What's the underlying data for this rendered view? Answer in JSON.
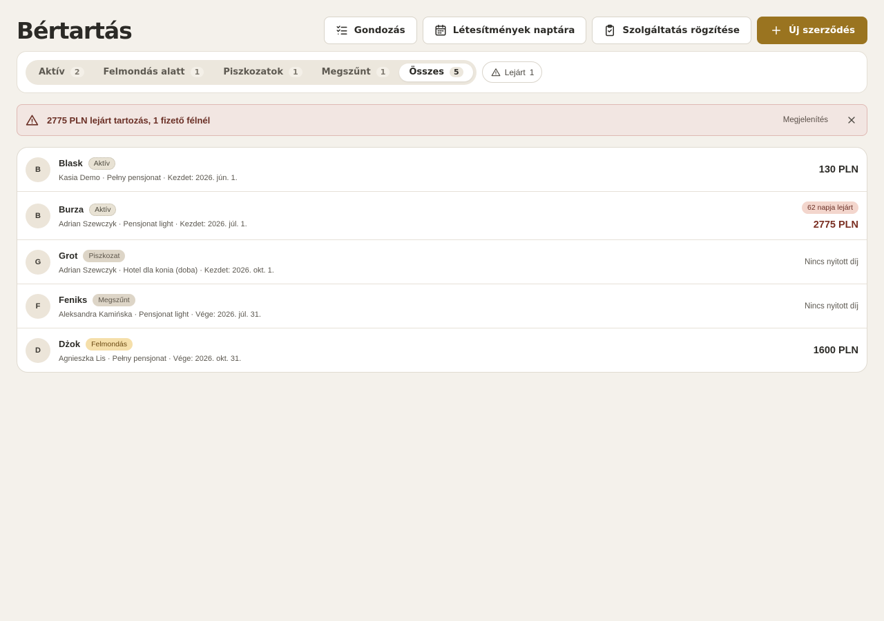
{
  "header": {
    "title": "Bértartás",
    "buttons": {
      "care": "Gondozás",
      "calendar": "Létesítmények naptára",
      "service": "Szolgáltatás rögzítése",
      "new_contract": "Új szerződés"
    }
  },
  "filters": {
    "tabs": [
      {
        "label": "Aktív",
        "count": "2"
      },
      {
        "label": "Felmondás alatt",
        "count": "1"
      },
      {
        "label": "Piszkozatok",
        "count": "1"
      },
      {
        "label": "Megszűnt",
        "count": "1"
      },
      {
        "label": "Összes",
        "count": "5"
      }
    ],
    "overdue": {
      "label": "Lejárt",
      "count": "1"
    }
  },
  "alert": {
    "text": "2775 PLN lejárt tartozás, 1 fizető félnél",
    "action": "Megjelenítés"
  },
  "contracts": [
    {
      "initial": "B",
      "name": "Blask",
      "status": "Aktív",
      "meta": "Kasia Demo · Pełny pensjonat · Kezdet: 2026. jún. 1.",
      "amount": "130 PLN"
    },
    {
      "initial": "B",
      "name": "Burza",
      "status": "Aktív",
      "meta": "Adrian Szewczyk · Pensjonat light · Kezdet: 2026. júl. 1.",
      "due": "62 napja lejárt",
      "amount": "2775 PLN"
    },
    {
      "initial": "G",
      "name": "Grot",
      "status": "Piszkozat",
      "meta": "Adrian Szewczyk · Hotel dla konia (doba) · Kezdet: 2026. okt. 1.",
      "none": "Nincs nyitott díj"
    },
    {
      "initial": "F",
      "name": "Feniks",
      "status": "Megszűnt",
      "meta": "Aleksandra Kamińska · Pensjonat light · Vége: 2026. júl. 31.",
      "none": "Nincs nyitott díj"
    },
    {
      "initial": "D",
      "name": "Dżok",
      "status": "Felmondás",
      "meta": "Agnieszka Lis · Pełny pensjonat · Vége: 2026. okt. 31.",
      "amount": "1600 PLN"
    }
  ]
}
